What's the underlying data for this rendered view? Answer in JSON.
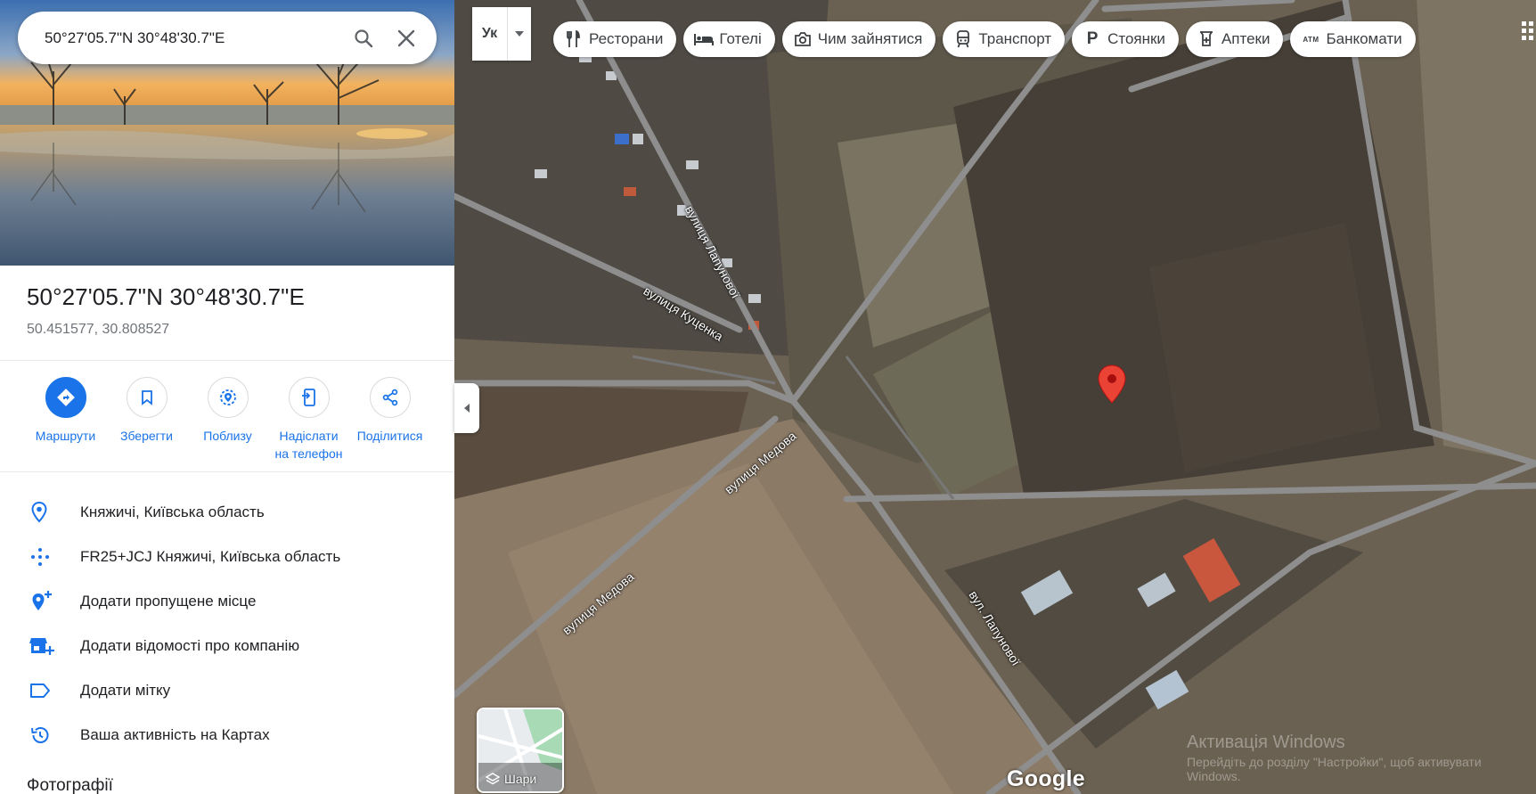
{
  "search": {
    "query": "50°27'05.7\"N 30°48'30.7\"E"
  },
  "place": {
    "title": "50°27'05.7\"N 30°48'30.7\"E",
    "decimal": "50.451577, 30.808527"
  },
  "actions": [
    {
      "label": "Маршрути",
      "icon": "directions-icon"
    },
    {
      "label": "Зберегти",
      "icon": "bookmark-icon"
    },
    {
      "label": "Поблизу",
      "icon": "nearby-icon"
    },
    {
      "label_line1": "Надіслати",
      "label_line2": "на телефон",
      "icon": "send-to-phone-icon"
    },
    {
      "label": "Поділитися",
      "icon": "share-icon"
    }
  ],
  "info_rows": [
    {
      "text": "Княжичі, Київська область",
      "icon": "location-pin-icon"
    },
    {
      "text": "FR25+JCJ Княжичі, Київська область",
      "icon": "plus-code-icon"
    },
    {
      "text": "Додати пропущене місце",
      "icon": "add-place-icon"
    },
    {
      "text": "Додати відомості про компанію",
      "icon": "add-business-icon"
    },
    {
      "text": "Додати мітку",
      "icon": "label-icon"
    },
    {
      "text": "Ваша активність на Картах",
      "icon": "history-icon"
    }
  ],
  "photos_heading": "Фотографії",
  "map": {
    "language_label": "Ук",
    "chips": [
      {
        "label": "Ресторани",
        "icon": "restaurant-icon"
      },
      {
        "label": "Готелі",
        "icon": "hotel-icon"
      },
      {
        "label": "Чим зайнятися",
        "icon": "camera-icon"
      },
      {
        "label": "Транспорт",
        "icon": "transit-icon"
      },
      {
        "label": "Стоянки",
        "icon": "parking-icon",
        "glyph": "P"
      },
      {
        "label": "Аптеки",
        "icon": "pharmacy-icon"
      },
      {
        "label": "Банкомати",
        "icon": "atm-icon",
        "glyph": "ATM"
      }
    ],
    "street_labels": [
      "вулиця Лапунової",
      "вулиця Куценка",
      "вулиця Медова",
      "вулиця Медова",
      "вул. Лапунової"
    ],
    "layers_label": "Шари",
    "watermark_title": "Активація Windows",
    "watermark_sub": "Перейдіть до розділу \"Настройки\", щоб активувати Windows.",
    "logo_text": "Google",
    "marker_color": "#ea4335"
  }
}
